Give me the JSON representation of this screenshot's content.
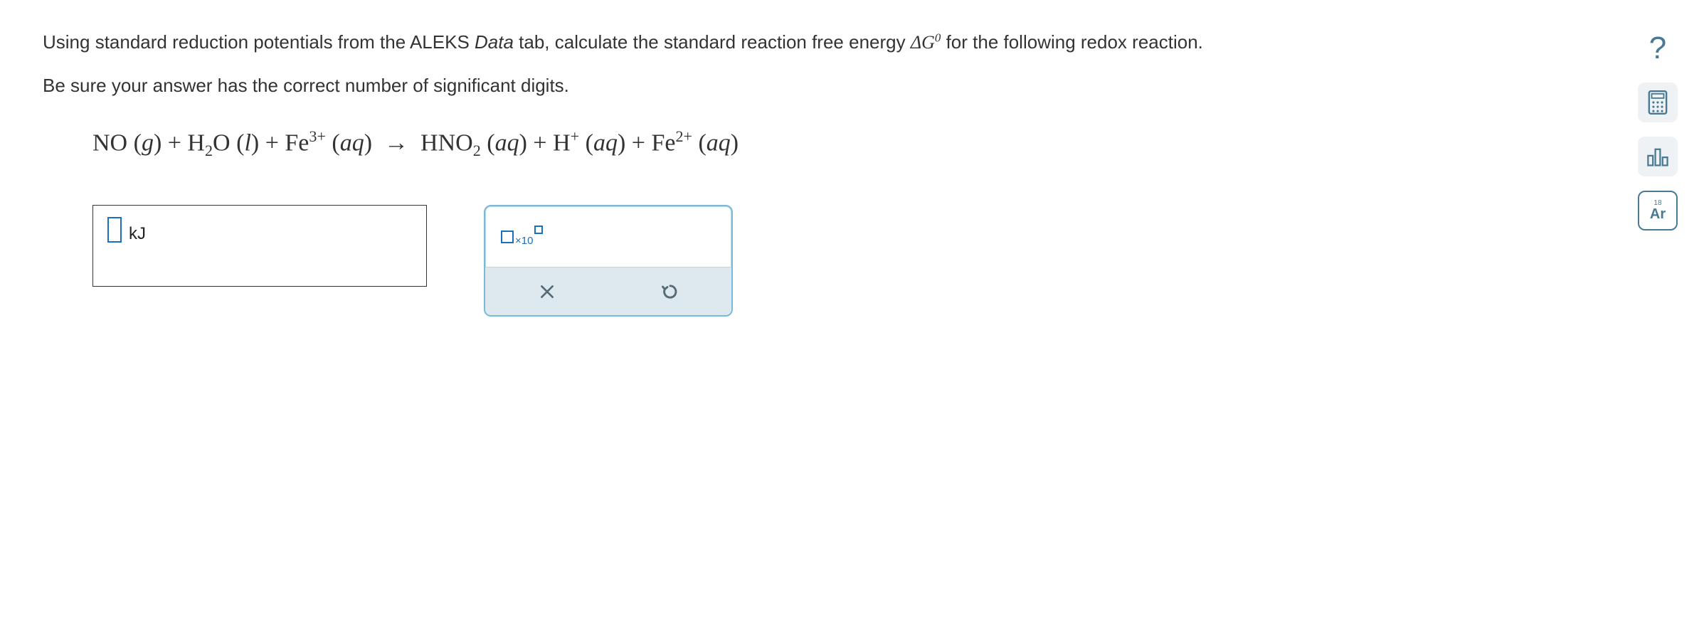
{
  "question": {
    "line1_pre": "Using standard reduction potentials from the ALEKS ",
    "data_word": "Data",
    "line1_mid": " tab, calculate the standard reaction free energy ",
    "delta_g": "ΔG",
    "delta_g_sup": "0",
    "line1_post": " for the following redox reaction.",
    "line2": "Be sure your answer has the correct number of significant digits."
  },
  "equation": {
    "text_plain": "NO (g) + H2O (l) + Fe3+ (aq) → HNO2 (aq) + H+ (aq) + Fe2+ (aq)"
  },
  "answer": {
    "unit": "kJ",
    "value": ""
  },
  "tools": {
    "sci_label": "×10",
    "clear_label": "×",
    "reset_label": "↺"
  },
  "sidebar": {
    "help": "?",
    "calculator": "calculator-icon",
    "graph": "graph-icon",
    "periodic": "Ar"
  }
}
